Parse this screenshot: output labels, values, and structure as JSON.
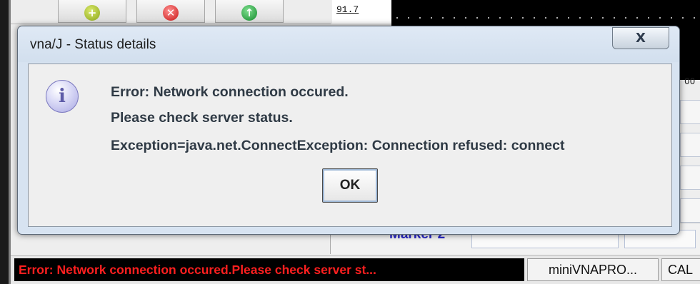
{
  "toolbar": {
    "buttons": [
      {
        "icon": "green-plus-icon",
        "glyph": "+"
      },
      {
        "icon": "red-x-icon",
        "glyph": "✕"
      },
      {
        "icon": "green-up-arrow-icon",
        "glyph": "↑"
      }
    ],
    "value": "91.7"
  },
  "scope": {
    "right_tick_text": "00"
  },
  "marker": {
    "label": "Marker 2"
  },
  "dialog": {
    "title": "vna/J - Status details",
    "close_label": "X",
    "icon": "info-icon",
    "icon_glyph": "i",
    "lines": [
      "Error: Network connection occured.",
      "Please check server status.",
      "Exception=java.net.ConnectException: Connection refused: connect"
    ],
    "ok_label": "OK"
  },
  "statusbar": {
    "error_text": "Error: Network connection occured.Please check server st...",
    "device_text": "miniVNAPRO...",
    "cal_text": "CAL"
  },
  "colors": {
    "status_error_fg": "#ff1f1f",
    "status_error_bg": "#000000",
    "marker_label": "#2a2acb",
    "dialog_frame": "#d7e3f1"
  }
}
